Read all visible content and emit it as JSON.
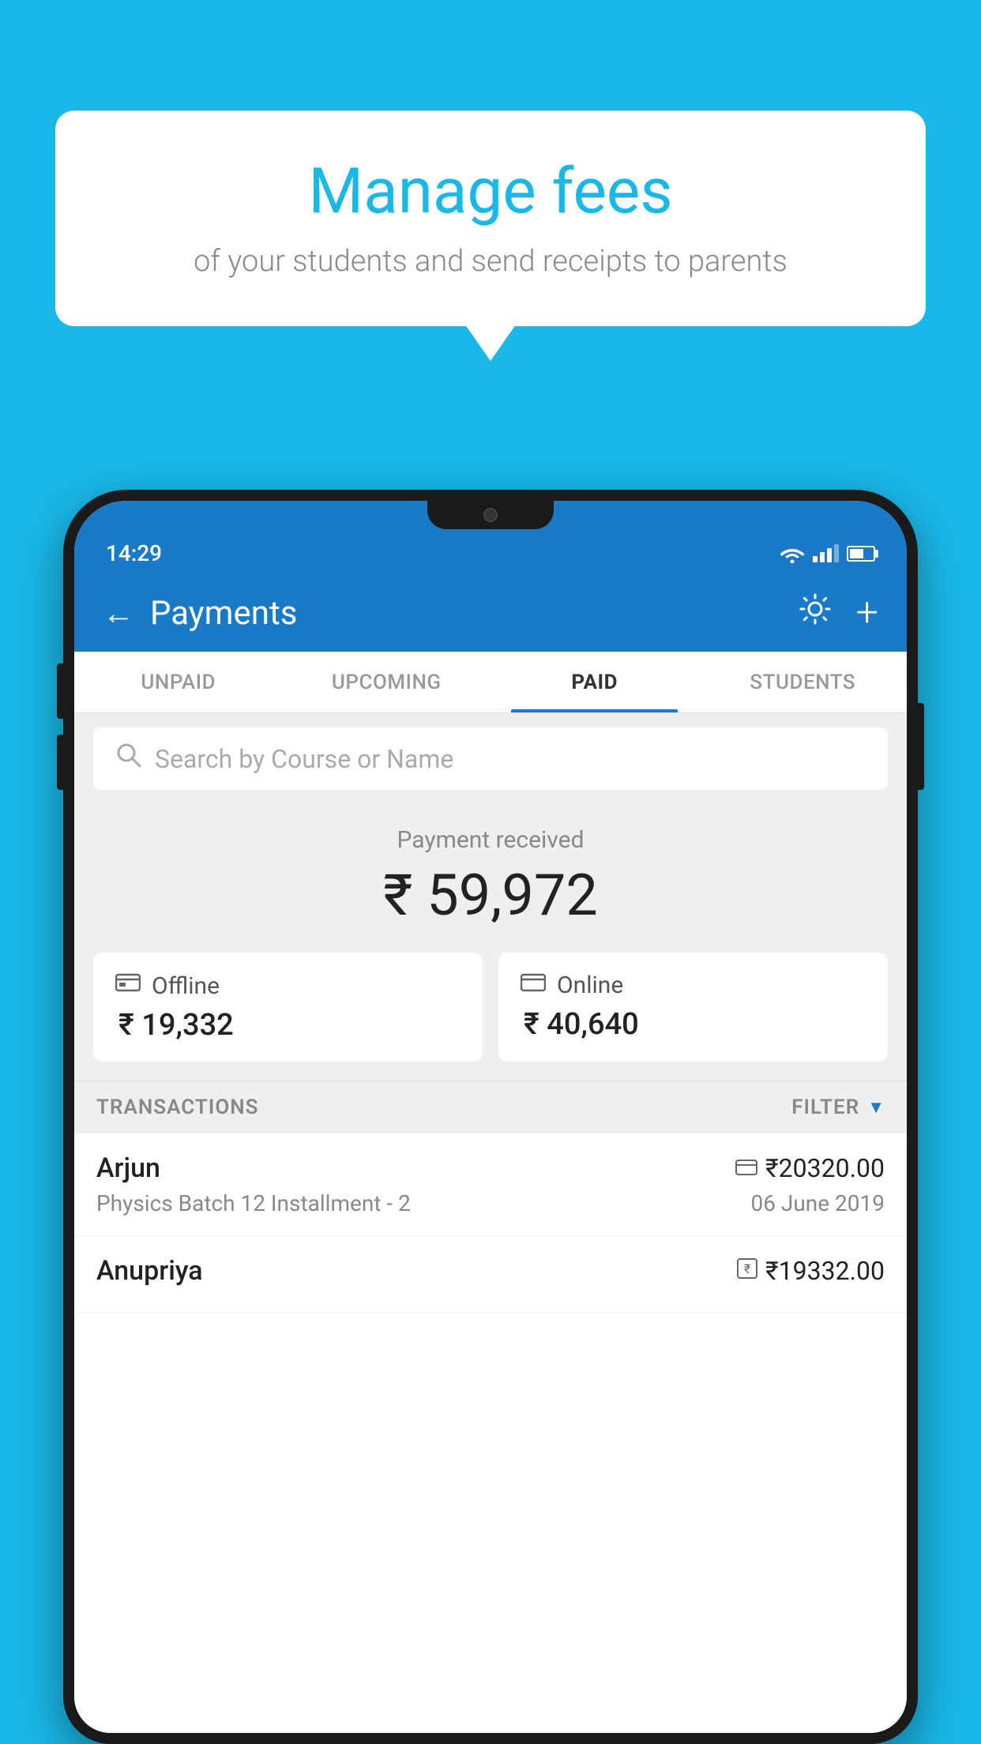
{
  "background_color": "#1ab8e8",
  "bubble": {
    "title": "Manage fees",
    "subtitle": "of your students and send receipts to parents"
  },
  "status_bar": {
    "time": "14:29"
  },
  "header": {
    "title": "Payments",
    "back_label": "←",
    "gear_label": "⚙",
    "plus_label": "+"
  },
  "tabs": [
    {
      "label": "UNPAID",
      "active": false
    },
    {
      "label": "UPCOMING",
      "active": false
    },
    {
      "label": "PAID",
      "active": true
    },
    {
      "label": "STUDENTS",
      "active": false
    }
  ],
  "search": {
    "placeholder": "Search by Course or Name"
  },
  "payment_received": {
    "label": "Payment received",
    "amount": "₹ 59,972"
  },
  "offline_card": {
    "icon": "₹",
    "label": "Offline",
    "amount": "₹ 19,332"
  },
  "online_card": {
    "icon": "▭",
    "label": "Online",
    "amount": "₹ 40,640"
  },
  "transactions_section": {
    "label": "TRANSACTIONS",
    "filter_label": "FILTER"
  },
  "transactions": [
    {
      "name": "Arjun",
      "course": "Physics Batch 12 Installment - 2",
      "amount": "₹20320.00",
      "date": "06 June 2019",
      "icon": "▭"
    },
    {
      "name": "Anupriya",
      "course": "",
      "amount": "₹19332.00",
      "date": "",
      "icon": "₹"
    }
  ]
}
